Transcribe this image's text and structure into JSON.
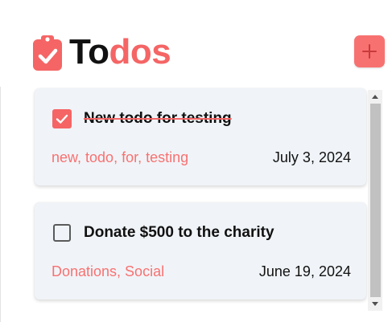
{
  "app": {
    "title_part1": "To",
    "title_part2": "dos",
    "logo_icon": "clipboard-check-icon",
    "accent_color": "#f56565"
  },
  "toolbar": {
    "add_icon": "plus-icon"
  },
  "todos": [
    {
      "title": "New todo for testing",
      "completed": true,
      "tags": "new, todo, for, testing",
      "date": "July 3, 2024"
    },
    {
      "title": "Donate $500 to the charity",
      "completed": false,
      "tags": "Donations, Social",
      "date": "June 19, 2024"
    }
  ]
}
